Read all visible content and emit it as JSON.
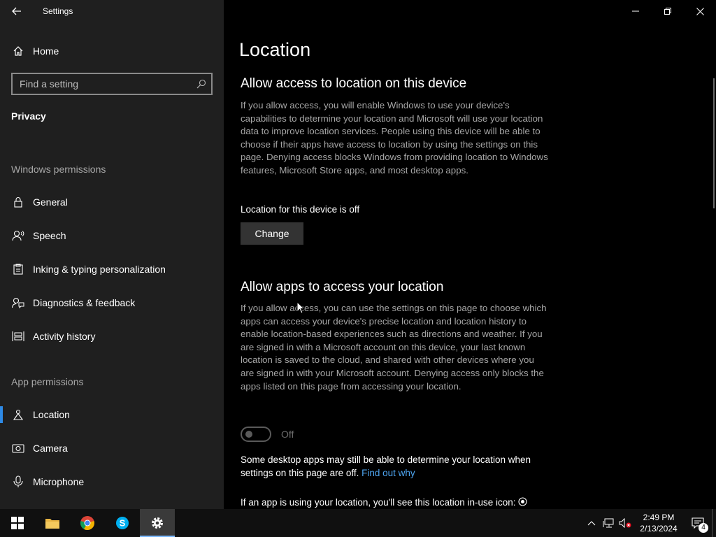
{
  "window": {
    "title": "Settings"
  },
  "sidebar": {
    "home_label": "Home",
    "search_placeholder": "Find a setting",
    "section_title": "Privacy",
    "groups": {
      "windows_permissions": "Windows permissions",
      "app_permissions": "App permissions"
    },
    "windows_items": [
      "General",
      "Speech",
      "Inking & typing personalization",
      "Diagnostics & feedback",
      "Activity history"
    ],
    "app_items": [
      "Location",
      "Camera",
      "Microphone"
    ],
    "active_item": "Location"
  },
  "main": {
    "page_title": "Location",
    "device_heading": "Allow access to location on this device",
    "device_desc": "If you allow access, you will enable Windows to use your device's capabilities to determine your location and Microsoft will use your location data to improve location services. People using this device will be able to choose if their apps have access to location by using the settings on this page. Denying access blocks Windows from providing location to Windows features, Microsoft Store apps, and most desktop apps.",
    "device_status": "Location for this device is off",
    "change_label": "Change",
    "apps_heading": "Allow apps to access your location",
    "apps_desc": "If you allow access, you can use the settings on this page to choose which apps can access your device's precise location and location history to enable location-based experiences such as directions and weather. If you are signed in with a Microsoft account on this device, your last known location is saved to the cloud, and shared with other devices where you are signed in with your Microsoft account. Denying access only blocks the apps listed on this page from accessing your location.",
    "toggle_state": "Off",
    "desktop_note": "Some desktop apps may still be able to determine your location when settings on this page are off.",
    "find_out_why": "Find out why",
    "in_use_note": "If an app is using your location, you'll see this location in-use icon:"
  },
  "taskbar": {
    "time": "2:49 PM",
    "date": "2/13/2024",
    "notification_count": "4"
  },
  "colors": {
    "accent": "#2e8ae6",
    "link": "#4ea5f0",
    "sidebar_bg": "#1f1f1f",
    "main_bg": "#000000"
  }
}
